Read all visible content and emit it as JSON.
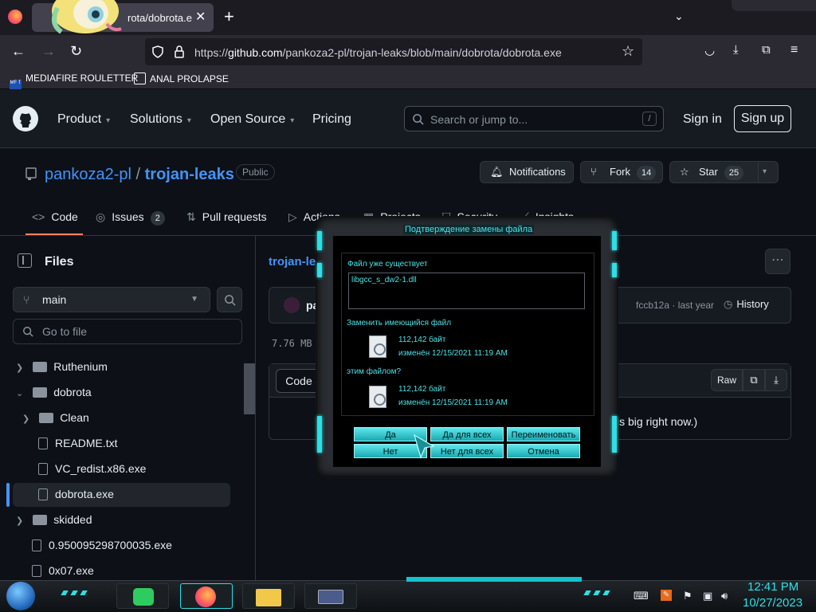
{
  "browser": {
    "tab_title": "rota/dobrota.e",
    "url_prefix": "https://",
    "url_host": "github.com",
    "url_path": "/pankoza2-pl/trojan-leaks/blob/main/dobrota/dobrota.exe",
    "bookmarks": [
      "MEDIAFIRE ROULETTER",
      "ANAL PROLAPSE"
    ],
    "bookmark_icon_text": "MF T"
  },
  "gh_header": {
    "nav": [
      "Product",
      "Solutions",
      "Open Source",
      "Pricing"
    ],
    "search_placeholder": "Search or jump to...",
    "search_key": "/",
    "sign_in": "Sign in",
    "sign_up": "Sign up"
  },
  "repo": {
    "owner": "pankoza2-pl",
    "separator": " / ",
    "name": "trojan-leaks",
    "visibility": "Public",
    "notifications": "Notifications",
    "fork_label": "Fork",
    "fork_count": "14",
    "star_label": "Star",
    "star_count": "25",
    "tabs": [
      "Code",
      "Issues",
      "Pull requests",
      "Actions",
      "Projects",
      "Security",
      "Insights"
    ],
    "issues_count": "2"
  },
  "sidebar": {
    "title": "Files",
    "branch": "main",
    "goto_placeholder": "Go to file",
    "tree": [
      {
        "label": "Ruthenium",
        "type": "folder"
      },
      {
        "label": "dobrota",
        "type": "folder"
      },
      {
        "label": "Clean",
        "type": "folder"
      },
      {
        "label": "README.txt",
        "type": "file"
      },
      {
        "label": "VC_redist.x86.exe",
        "type": "file"
      },
      {
        "label": "dobrota.exe",
        "type": "file"
      },
      {
        "label": "skidded",
        "type": "folder"
      },
      {
        "label": "0.950095298700035.exe",
        "type": "file"
      },
      {
        "label": "0x07.exe",
        "type": "file"
      }
    ]
  },
  "main": {
    "breadcrumb": "trojan-le",
    "author": "pan",
    "commit": "fccb12a · last year",
    "history": "History",
    "file_size": "7.76 MB",
    "code_tab": "Code",
    "raw": "Raw",
    "notice": "is big right now.)"
  },
  "dialog": {
    "title": "Подтверждение замены файла",
    "exists": "Файл уже существует",
    "filename": "libgcc_s_dw2-1.dll",
    "replace": "Заменить имеющийся файл",
    "old_size": "112,142 байт",
    "old_date": "изменён 12/15/2021 11:19 AM",
    "with": "этим файлом?",
    "new_size": "112,142 байт",
    "new_date": "изменён 12/15/2021 11:19 AM",
    "buttons": [
      "Да",
      "Да для всех",
      "Переименовать",
      "Нет",
      "Нет для всех",
      "Отмена"
    ]
  },
  "taskbar": {
    "time": "12:41 PM",
    "date": "10/27/2023"
  },
  "colors": {
    "accent": "#2be0e6",
    "link": "#4493f8",
    "tab_underline": "#f78166"
  }
}
